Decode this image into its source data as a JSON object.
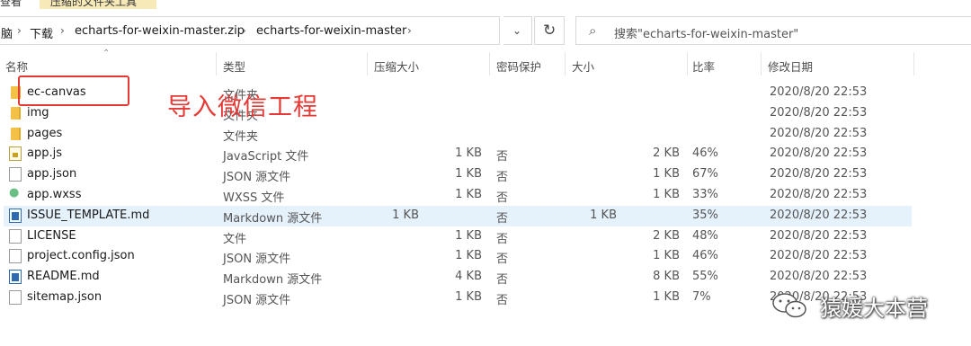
{
  "top_tabs": {
    "view": "查看",
    "tools": "压缩的文件夹工具"
  },
  "address": {
    "crumbs": [
      "脑",
      "下载",
      "echarts-for-weixin-master.zip",
      "echarts-for-weixin-master"
    ],
    "search_placeholder": "搜索\"echarts-for-weixin-master\""
  },
  "columns": {
    "name": "名称",
    "type": "类型",
    "compressed_size": "压缩大小",
    "password_protected": "密码保护",
    "size": "大小",
    "ratio": "比率",
    "modified": "修改日期"
  },
  "files": [
    {
      "name": "ec-canvas",
      "icon": "folder-icon",
      "type": "文件夹",
      "csize": "",
      "pwd": "",
      "size": "",
      "ratio": "",
      "date": "2020/8/20 22:53"
    },
    {
      "name": "img",
      "icon": "folder-icon",
      "type": "文件夹",
      "csize": "",
      "pwd": "",
      "size": "",
      "ratio": "",
      "date": "2020/8/20 22:53"
    },
    {
      "name": "pages",
      "icon": "folder-icon",
      "type": "文件夹",
      "csize": "",
      "pwd": "",
      "size": "",
      "ratio": "",
      "date": "2020/8/20 22:53"
    },
    {
      "name": "app.js",
      "icon": "js-file-icon",
      "type": "JavaScript 文件",
      "csize": "1 KB",
      "pwd": "否",
      "size": "2 KB",
      "ratio": "46%",
      "date": "2020/8/20 22:53"
    },
    {
      "name": "app.json",
      "icon": "json-file-icon",
      "type": "JSON 源文件",
      "csize": "1 KB",
      "pwd": "否",
      "size": "1 KB",
      "ratio": "67%",
      "date": "2020/8/20 22:53"
    },
    {
      "name": "app.wxss",
      "icon": "wxss-file-icon",
      "type": "WXSS 文件",
      "csize": "1 KB",
      "pwd": "否",
      "size": "1 KB",
      "ratio": "33%",
      "date": "2020/8/20 22:53"
    },
    {
      "name": "ISSUE_TEMPLATE.md",
      "icon": "markdown-file-icon",
      "type": "Markdown 源文件",
      "csize": "1 KB",
      "pwd": "否",
      "size": "1 KB",
      "ratio": "35%",
      "date": "2020/8/20 22:53"
    },
    {
      "name": "LICENSE",
      "icon": "file-icon",
      "type": "文件",
      "csize": "1 KB",
      "pwd": "否",
      "size": "2 KB",
      "ratio": "48%",
      "date": "2020/8/20 22:53"
    },
    {
      "name": "project.config.json",
      "icon": "json-file-icon",
      "type": "JSON 源文件",
      "csize": "1 KB",
      "pwd": "否",
      "size": "1 KB",
      "ratio": "46%",
      "date": "2020/8/20 22:53"
    },
    {
      "name": "README.md",
      "icon": "markdown-file-icon",
      "type": "Markdown 源文件",
      "csize": "4 KB",
      "pwd": "否",
      "size": "8 KB",
      "ratio": "55%",
      "date": "2020/8/20 22:53"
    },
    {
      "name": "sitemap.json",
      "icon": "json-file-icon",
      "type": "JSON 源文件",
      "csize": "1 KB",
      "pwd": "否",
      "size": "1 KB",
      "ratio": "7%",
      "date": "2020/8/20 22:53"
    }
  ],
  "annotation": {
    "text": "导入微信工程",
    "color": "#e53935"
  },
  "watermark": {
    "text": "猿媛大本营"
  },
  "colors": {
    "selected_row": "#e5f1fb",
    "folder": "#f3c145"
  }
}
